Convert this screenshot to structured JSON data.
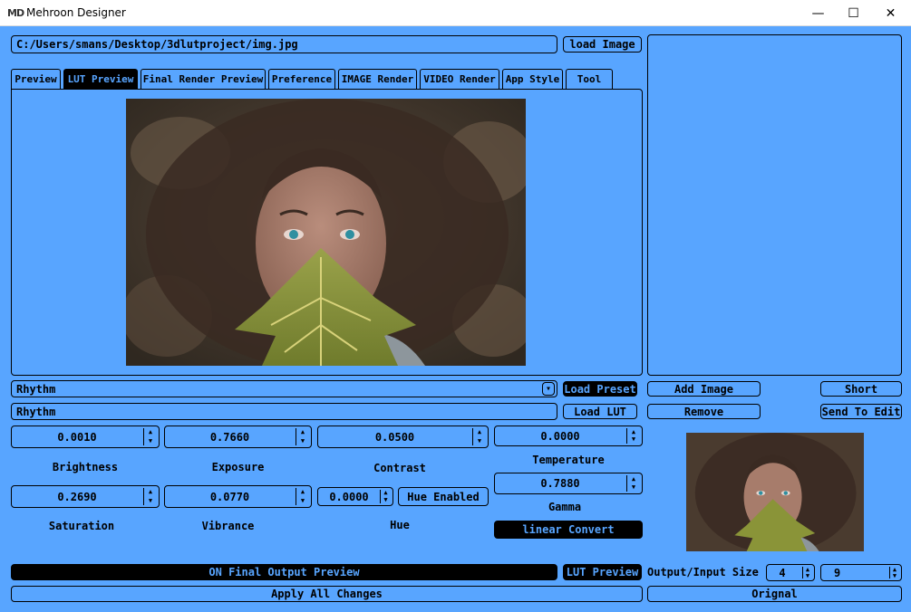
{
  "window": {
    "logo": "MD",
    "title": "Mehroon Designer",
    "minimize": "—",
    "maximize": "☐",
    "close": "✕"
  },
  "path": {
    "value": "C:/Users/smans/Desktop/3dlutproject/img.jpg",
    "load_image": "load Image"
  },
  "tabs": [
    "Preview",
    "LUT Preview",
    "Final Render Preview",
    "Preference",
    "IMAGE Render",
    "VIDEO Render",
    "App Style",
    "Tool"
  ],
  "active_tab": "LUT Preview",
  "preset": {
    "selected": "Rhythm",
    "load_preset": "Load Preset",
    "lut_name": "Rhythm",
    "load_lut": "Load LUT"
  },
  "side": {
    "add_image": "Add Image",
    "short": "Short",
    "remove": "Remove",
    "send_to_edit": "Send To Edit"
  },
  "controls": {
    "brightness": {
      "value": "0.0010",
      "label": "Brightness"
    },
    "exposure": {
      "value": "0.7660",
      "label": "Exposure"
    },
    "contrast": {
      "value": "0.0500",
      "label": "Contrast"
    },
    "temperature": {
      "value": "0.0000",
      "label": "Temperature"
    },
    "saturation": {
      "value": "0.2690",
      "label": "Saturation"
    },
    "vibrance": {
      "value": "0.0770",
      "label": "Vibrance"
    },
    "hue": {
      "value": "0.0000",
      "label": "Hue",
      "toggle": "Hue Enabled"
    },
    "gamma": {
      "value": "0.7880",
      "label": "Gamma"
    },
    "linear_convert": "linear Convert"
  },
  "bottom": {
    "final_output": "ON Final Output Preview",
    "lut_preview": "LUT Preview",
    "size_label": "Output/Input Size",
    "size_a": "4",
    "size_b": "9",
    "apply": "Apply All Changes",
    "original": "Orignal"
  },
  "icons": {
    "dropdown": "▾",
    "spin_up": "▲",
    "spin_down": "▼"
  },
  "colors": {
    "background": "#58a5ff",
    "dark": "#000000"
  }
}
